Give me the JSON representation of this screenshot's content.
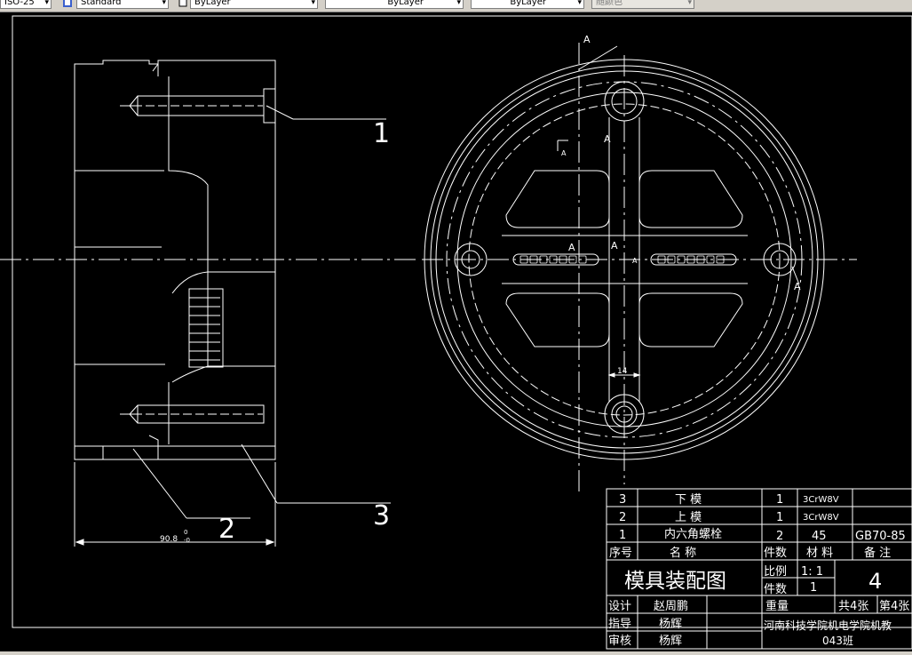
{
  "toolbar": {
    "text_style_value": "Standard",
    "layer_value": "ByLayer",
    "linetype_value": "ByLayer",
    "lineweight_value": "ByLayer",
    "plotstyle_value": "随颜色",
    "dimscale_value": "ISO-25"
  },
  "drawing": {
    "balloons": {
      "b1": "1",
      "b2": "2",
      "b3": "3"
    },
    "dimension_width": "90.8",
    "dimension_tol_upper": "0",
    "dimension_tol_lower": "-0",
    "dimension_slot": "14",
    "section_labels": [
      "A",
      "A",
      "A",
      "A",
      "A",
      "A",
      "A"
    ]
  },
  "title_block": {
    "parts": [
      {
        "no": "3",
        "name": "下  模",
        "qty": "1",
        "material": "3CrW8V",
        "remark": ""
      },
      {
        "no": "2",
        "name": "上  模",
        "qty": "1",
        "material": "3CrW8V",
        "remark": ""
      },
      {
        "no": "1",
        "name": "内六角螺栓",
        "qty": "2",
        "material": "45",
        "remark": "GB70-85"
      }
    ],
    "header": {
      "no": "序号",
      "name": "名  称",
      "qty": "件数",
      "material": "材 料",
      "remark": "备 注"
    },
    "drawing_title": "模具装配图",
    "scale_label": "比例",
    "scale_value": "1: 1",
    "count_label": "件数",
    "count_value": "1",
    "weight_label": "重量",
    "sheet_total": "共4张",
    "sheet_no": "第4张",
    "drawing_no": "4",
    "designer_label": "设计",
    "designer_name": "赵周鹏",
    "drafter_label": "指导",
    "drafter_name": "杨辉",
    "checker_label": "审核",
    "checker_name": "杨辉",
    "school": "河南科技学院机电学院机教",
    "class": "043班"
  },
  "colors": {
    "background": "#000000",
    "lines": "#ffffff",
    "toolbar": "#d4d0c8"
  }
}
